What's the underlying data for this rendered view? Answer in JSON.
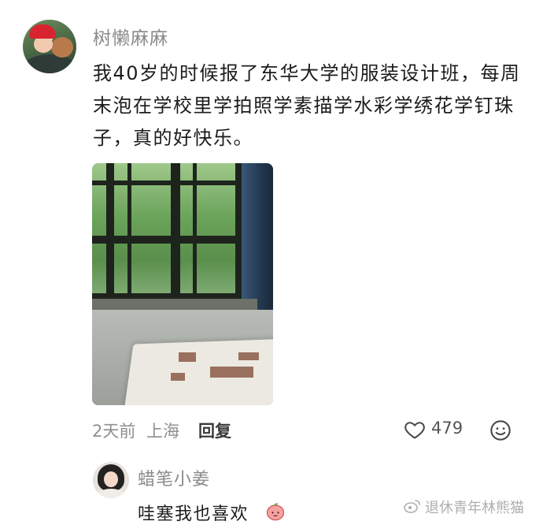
{
  "comment": {
    "username": "树懒麻麻",
    "text": "我40岁的时候报了东华大学的服装设计班，每周末泡在学校里学拍照学素描学水彩学绣花学钉珠子，真的好快乐。",
    "time": "2天前",
    "location": "上海",
    "reply_label": "回复",
    "like_count": "479",
    "icons": {
      "like": "heart-outline-icon",
      "emoji": "smiley-face-icon"
    }
  },
  "reply": {
    "username": "蜡笔小姜",
    "text": "哇塞我也喜欢",
    "emoji": "peach-emoji-icon"
  },
  "watermark": {
    "text": "退休青年林熊猫",
    "icon": "weibo-logo-icon"
  },
  "colors": {
    "username_gray": "#8a8a8a",
    "text_dark": "#1c1c1c",
    "meta_gray": "#8f8f8f"
  }
}
